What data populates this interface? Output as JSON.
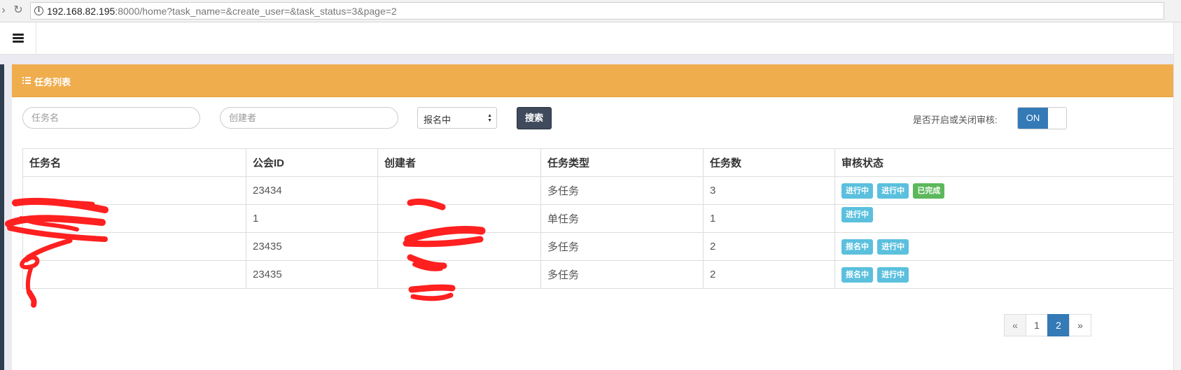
{
  "browser": {
    "url_host": "192.168.82.195",
    "url_rest": ":8000/home?task_name=&create_user=&task_status=3&page=2"
  },
  "panel": {
    "title": "任务列表"
  },
  "filters": {
    "task_name_placeholder": "任务名",
    "creator_placeholder": "创建者",
    "status_selected": "报名中",
    "search_label": "搜索",
    "audit_label": "是否开启或关闭审核:",
    "audit_toggle": "ON"
  },
  "table": {
    "headers": [
      "任务名",
      "公会ID",
      "创建者",
      "任务类型",
      "任务数",
      "审核状态"
    ],
    "rows": [
      {
        "guild_id": "23434",
        "type": "多任务",
        "count": "3",
        "badges": [
          "进行中",
          "进行中",
          "已完成"
        ]
      },
      {
        "guild_id": "1",
        "type": "单任务",
        "count": "1",
        "badges": [
          "进行中"
        ]
      },
      {
        "guild_id": "23435",
        "type": "多任务",
        "count": "2",
        "badges": [
          "报名中",
          "进行中"
        ]
      },
      {
        "guild_id": "23435",
        "type": "多任务",
        "count": "2",
        "badges": [
          "报名中",
          "进行中"
        ]
      }
    ]
  },
  "pagination": {
    "prev": "«",
    "pages": [
      "1",
      "2"
    ],
    "next": "»",
    "current": "2"
  },
  "colors": {
    "panel_header": "#f0ad4e",
    "primary": "#337ab7",
    "badge_info": "#5bc0de",
    "badge_success": "#5cb85c",
    "redaction": "#ff2020"
  }
}
